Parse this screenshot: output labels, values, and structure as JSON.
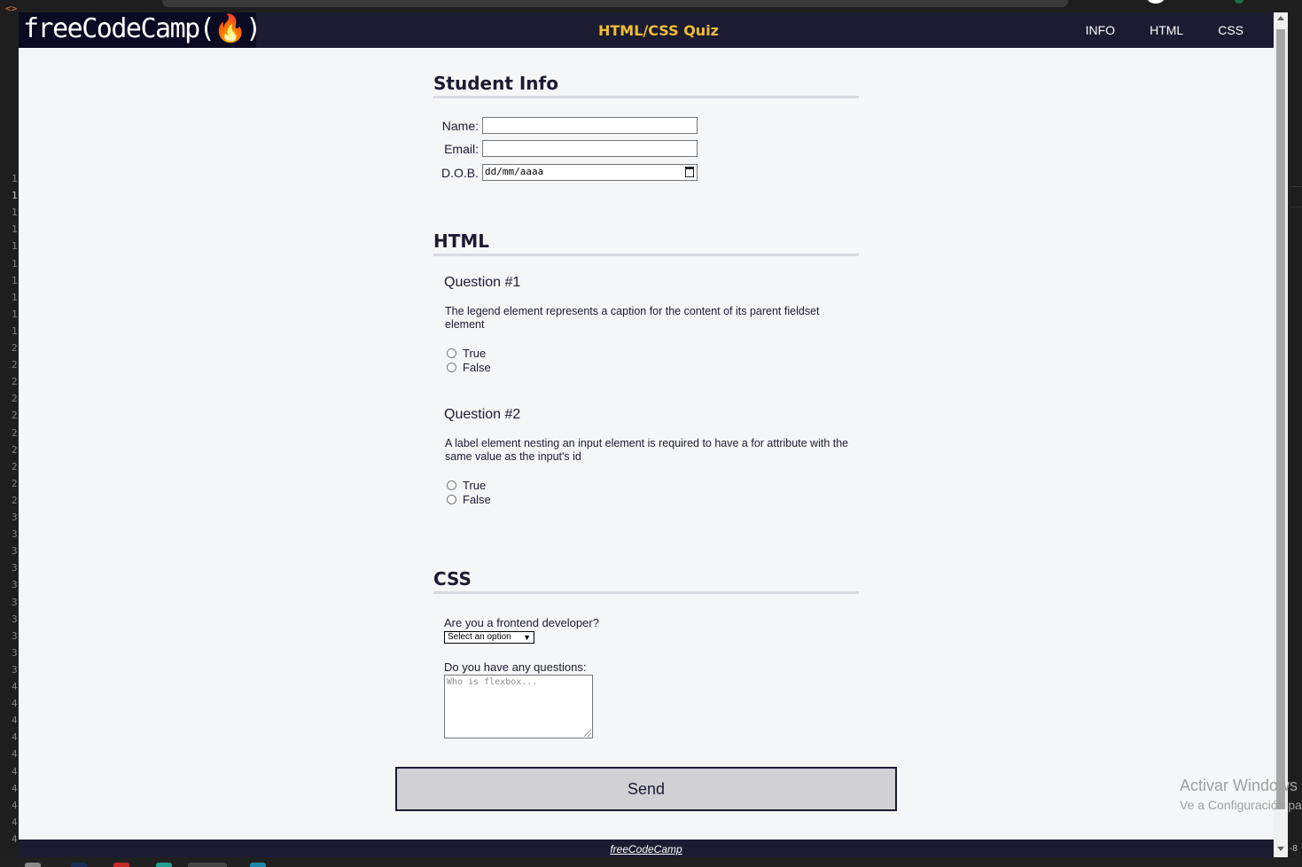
{
  "editor": {
    "tag_glyph": "<>",
    "line_numbers": [
      "1",
      "1",
      "1",
      "1",
      "1",
      "1",
      "1",
      "1",
      "1",
      "1",
      "2",
      "2",
      "2",
      "2",
      "2",
      "2",
      "2",
      "2",
      "2",
      "2",
      "3",
      "3",
      "3",
      "3",
      "3",
      "3",
      "3",
      "3",
      "3",
      "3",
      "4",
      "4",
      "4",
      "4",
      "4",
      "4",
      "4",
      "4",
      "4",
      "4"
    ],
    "edge_text": "-8"
  },
  "header": {
    "logo_text": "freeCodeCamp(🔥)",
    "title": "HTML/CSS Quiz",
    "nav": [
      "INFO",
      "HTML",
      "CSS"
    ]
  },
  "student_info": {
    "heading": "Student Info",
    "name_label": "Name:",
    "email_label": "Email:",
    "dob_label": "D.O.B.",
    "dob_value": "dd/mm/aaaa"
  },
  "html_section": {
    "heading": "HTML",
    "questions": [
      {
        "title": "Question #1",
        "text": "The legend element represents a caption for the content of its parent fieldset element",
        "options": [
          "True",
          "False"
        ]
      },
      {
        "title": "Question #2",
        "text": "A label element nesting an input element is required to have a for attribute with the same value as the input's id",
        "options": [
          "True",
          "False"
        ]
      }
    ]
  },
  "css_section": {
    "heading": "CSS",
    "frontend_question": "Are you a frontend developer?",
    "select_value": "Select an option",
    "questions_label": "Do you have any questions:",
    "textarea_placeholder": "Who is flexbox..."
  },
  "send_label": "Send",
  "footer": {
    "link_text": "freeCodeCamp"
  },
  "watermark": {
    "line1": "Activar Windows",
    "line2": "Ve a Configuración para activar Windows."
  },
  "colors": {
    "navbar": "#1b1b32",
    "logo_bg": "#0a0a23",
    "title": "#f1be32",
    "page_bg": "#f4f6f7",
    "button_bg": "#d0d0d5"
  }
}
